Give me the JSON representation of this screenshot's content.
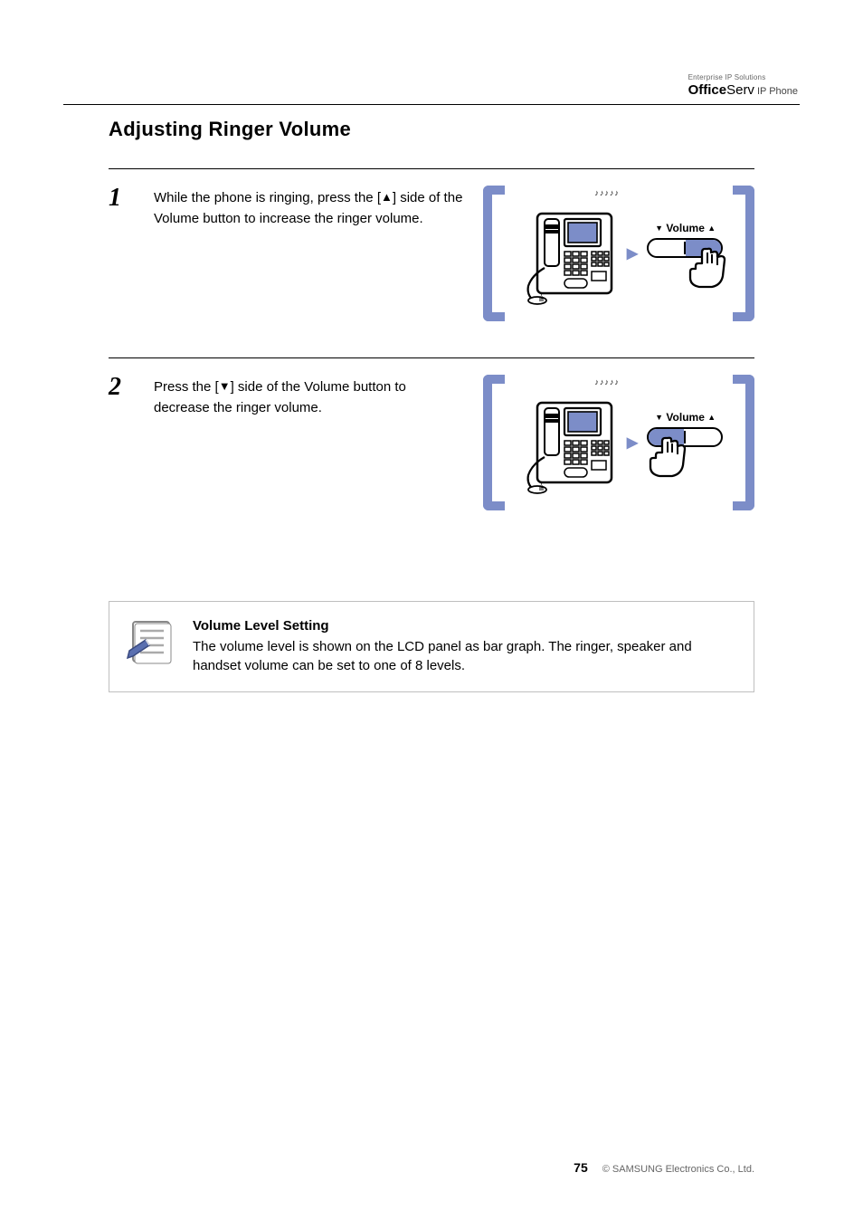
{
  "brand": {
    "small_tag": "Enterprise IP Solutions",
    "office": "Office",
    "serv": "Serv",
    "ipphone": "IP Phone"
  },
  "section": {
    "title": "Adjusting Ringer Volume"
  },
  "steps": [
    {
      "num": "1",
      "text_a": "While the phone is ringing, press the ",
      "arrow": "▲",
      "text_b": " side of the Volume button to increase the ringer volume.",
      "ring_sound": "♪♪♪♪♪"
    },
    {
      "num": "2",
      "text_a": "Press the ",
      "arrow": "▼",
      "text_b": " side of the Volume button to decrease the ringer volume.",
      "ring_sound": "♪♪♪♪♪"
    }
  ],
  "volume_label": {
    "down": "▼",
    "text": "Volume",
    "up": "▲"
  },
  "note": {
    "title": "Volume Level Setting",
    "body": "The volume level is shown on the LCD panel as bar graph. The ringer, speaker and handset volume can be set to one of 8 levels."
  },
  "footer": {
    "pagenum": "75",
    "copyright": "© SAMSUNG Electronics Co., Ltd."
  }
}
